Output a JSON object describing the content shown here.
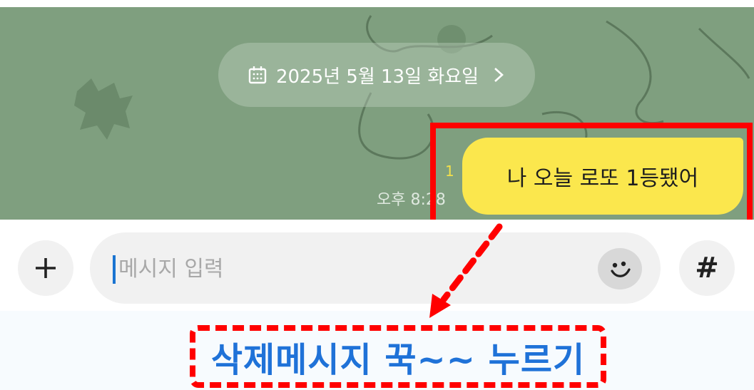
{
  "chat": {
    "date_label": "2025년 5월 13일 화요일",
    "unread_count": "1",
    "time": "오후 8:28",
    "message": "나 오늘 로또 1등됐어",
    "wallpaper_color": "#7f9f7f",
    "bubble_color": "#fbe74d"
  },
  "input_bar": {
    "placeholder": "메시지 입력",
    "plus_icon": "plus-icon",
    "emoji_icon": "smiley-icon",
    "hash_label": "#"
  },
  "annotation": {
    "caption": "삭제메시지 꾹~~ 누르기",
    "highlight_color": "#ff0000",
    "caption_color": "#1f72d8"
  }
}
